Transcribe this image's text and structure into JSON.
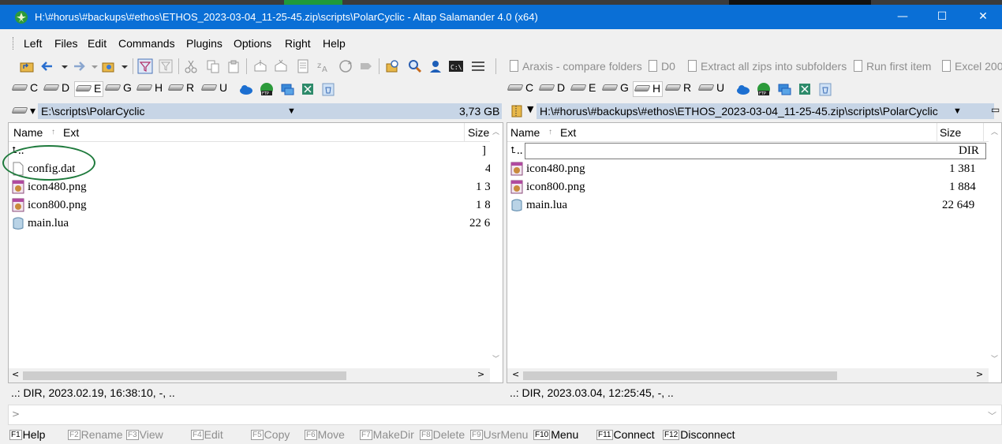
{
  "window": {
    "title": "H:\\#horus\\#backups\\#ethos\\ETHOS_2023-03-04_11-25-45.zip\\scripts\\PolarCyclic - Altap Salamander 4.0 (x64)",
    "minimize_glyph": "—",
    "maximize_glyph": "☐",
    "close_glyph": "✕"
  },
  "menu": [
    "Left",
    "Files",
    "Edit",
    "Commands",
    "Plugins",
    "Options",
    "Right",
    "Help"
  ],
  "user_buttons": [
    "Araxis - compare folders",
    "D0",
    "Extract all zips into subfolders",
    "Run first item",
    "Excel 200"
  ],
  "left_drives": [
    "C",
    "D",
    "E",
    "G",
    "H",
    "R",
    "U"
  ],
  "right_drives": [
    "C",
    "D",
    "E",
    "G",
    "H",
    "R",
    "U"
  ],
  "left_panel": {
    "path": "E:\\scripts\\PolarCyclic",
    "free_space": "3,73 GB",
    "col_name": "Name",
    "col_ext": "Ext",
    "col_size": "Size",
    "rows": [
      {
        "name": "..",
        "size": "]"
      },
      {
        "name": "config.dat",
        "size": "4"
      },
      {
        "name": "icon480.png",
        "size": "1 3"
      },
      {
        "name": "icon800.png",
        "size": "1 8"
      },
      {
        "name": "main.lua",
        "size": "22 6"
      }
    ],
    "status": "..: DIR, 2023.02.19, 16:38:10, -, .."
  },
  "right_panel": {
    "path": "H:\\#horus\\#backups\\#ethos\\ETHOS_2023-03-04_11-25-45.zip\\scripts\\PolarCyclic",
    "col_name": "Name",
    "col_ext": "Ext",
    "col_size": "Size",
    "rows": [
      {
        "name": "..",
        "size": "DIR"
      },
      {
        "name": "icon480.png",
        "size": "1 381"
      },
      {
        "name": "icon800.png",
        "size": "1 884"
      },
      {
        "name": "main.lua",
        "size": "22 649"
      }
    ],
    "status": "..: DIR, 2023.03.04, 12:25:45, -, .."
  },
  "command_line": {
    "prompt": ">",
    "value": ""
  },
  "fkeys": [
    {
      "key": "F1",
      "label": "Help",
      "enabled": true
    },
    {
      "key": "F2",
      "label": "Rename",
      "enabled": false
    },
    {
      "key": "F3",
      "label": "View",
      "enabled": false
    },
    {
      "key": "F4",
      "label": "Edit",
      "enabled": false
    },
    {
      "key": "F5",
      "label": "Copy",
      "enabled": false
    },
    {
      "key": "F6",
      "label": "Move",
      "enabled": false
    },
    {
      "key": "F7",
      "label": "MakeDir",
      "enabled": false
    },
    {
      "key": "F8",
      "label": "Delete",
      "enabled": false
    },
    {
      "key": "F9",
      "label": "UsrMenu",
      "enabled": false
    },
    {
      "key": "F10",
      "label": "Menu",
      "enabled": true
    },
    {
      "key": "F11",
      "label": "Connect",
      "enabled": true
    },
    {
      "key": "F12",
      "label": "Disconnect",
      "enabled": true
    }
  ],
  "colors": {
    "titlebar": "#0a6fd6",
    "path_bg": "#c7d5e6",
    "annotation": "#1e7a3c"
  }
}
